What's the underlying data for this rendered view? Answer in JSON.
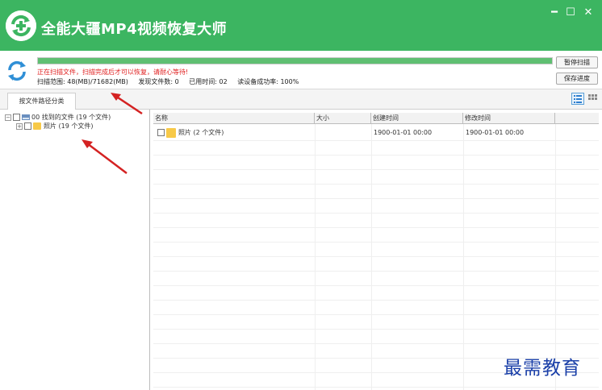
{
  "app": {
    "title": "全能大疆MP4视频恢复大师"
  },
  "window": {
    "minimize": "━",
    "maximize": "☐",
    "close": "✕"
  },
  "scan": {
    "progress_fraction": 1.0,
    "message": "正在扫描文件，扫描完成后才可以恢复，请耐心等待!",
    "range_label": "扫描范围: 48(MB)/71682(MB)",
    "found_label": "发现文件数: 0",
    "time_label": "已用时间: 02",
    "success_label": "读设备成功率: 100%"
  },
  "buttons": {
    "pause": "暂停扫描",
    "save": "保存进度"
  },
  "tabs": [
    {
      "label": "按文件路径分类"
    }
  ],
  "tree": {
    "root": {
      "toggle": "−",
      "label": "00 找到的文件 (19 个文件)"
    },
    "child": {
      "toggle": "+",
      "label": "照片    (19 个文件)"
    }
  },
  "table": {
    "columns": [
      "名称",
      "大小",
      "创建时间",
      "修改时间"
    ],
    "rows": [
      {
        "name": "照片    (2 个文件)",
        "size": "",
        "created": "1900-01-01  00:00",
        "modified": "1900-01-01  00:00"
      }
    ]
  },
  "watermark": "最需教育",
  "colors": {
    "title_bar": "#3cb561",
    "message": "#e02020",
    "annotation": "#d42222",
    "watermark": "#1a3fa8"
  }
}
